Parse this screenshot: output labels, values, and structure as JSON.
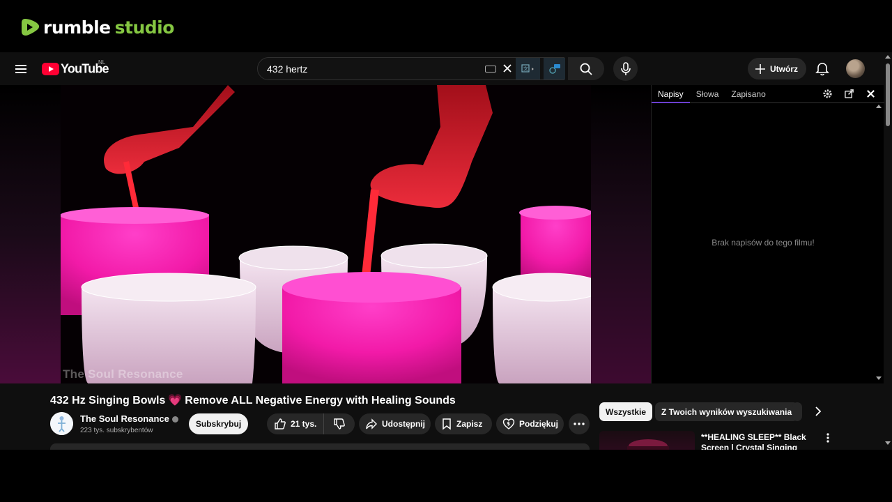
{
  "rumble": {
    "brand": "rumble",
    "product": "studio",
    "brand_color": "#85c742"
  },
  "youtube": {
    "logo_text": "YouTube",
    "country": "NL",
    "search": {
      "value": "432 hertz"
    },
    "create_label": "Utwórz",
    "icons": [
      "menu-icon",
      "keyboard-icon",
      "clear-icon",
      "translate-icon",
      "captions-extension-icon",
      "search-icon",
      "microphone-icon",
      "plus-icon",
      "bell-icon"
    ]
  },
  "video": {
    "watermark": "The Soul Resonance",
    "title": "432 Hz Singing Bowls",
    "title_emoji": "💗",
    "title_rest": "Remove ALL Negative Energy with Healing Sounds"
  },
  "subtitles_panel": {
    "tabs": [
      {
        "label": "Napisy",
        "active": true
      },
      {
        "label": "Słowa",
        "active": false
      },
      {
        "label": "Zapisano",
        "active": false
      }
    ],
    "empty_message": "Brak napisów do tego filmu!"
  },
  "channel": {
    "name": "The Soul Resonance",
    "subscribers": "223 tys. subskrybentów",
    "subscribe_label": "Subskrybuj"
  },
  "actions": {
    "likes": "21 tys.",
    "share": "Udostępnij",
    "save": "Zapisz",
    "thanks": "Podziękuj"
  },
  "chips": [
    {
      "label": "Wszystkie",
      "active": true
    },
    {
      "label": "Z Twoich wyników wyszukiwania",
      "active": false
    }
  ],
  "recommendation": {
    "title": "**HEALING SLEEP** Black Screen | Crystal Singing Bowls"
  }
}
